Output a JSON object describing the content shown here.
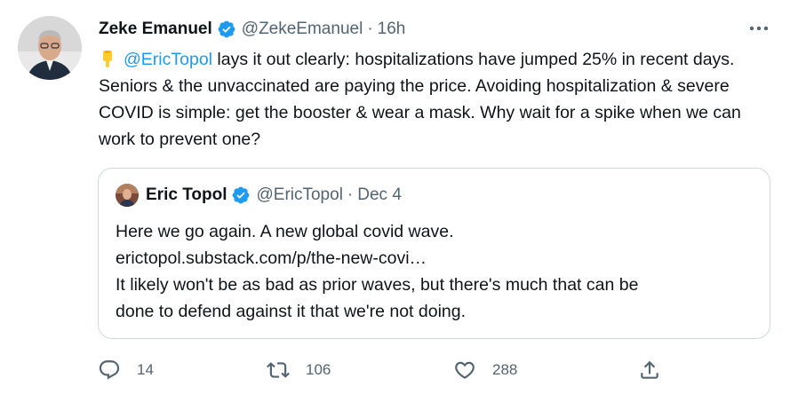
{
  "tweet": {
    "author_name": "Zeke Emanuel",
    "author_handle": "@ZekeEmanuel",
    "separator": "·",
    "time": "16h",
    "emoji": "👇",
    "mention": "@EricTopol",
    "text_rest": " lays it out clearly: hospitalizations have jumped 25% in recent days. Seniors & the unvaccinated are paying the price. Avoiding hospitalization & severe COVID is simple: get the booster & wear a mask. Why wait for a spike when we can work to prevent one?"
  },
  "quote": {
    "author_name": "Eric Topol",
    "author_handle": "@EricTopol",
    "separator": "·",
    "date": "Dec 4",
    "lines": [
      "Here we go again. A new global covid wave.",
      "erictopol.substack.com/p/the-new-covi…",
      "It likely won't be as bad as prior waves, but there's much that can be",
      "done to defend against it that we're not doing."
    ]
  },
  "actions": {
    "reply_count": "14",
    "retweet_count": "106",
    "like_count": "288"
  },
  "colors": {
    "accent": "#1d9bf0",
    "secondary_text": "#536471",
    "primary_text": "#0f1419",
    "border": "#cfd9de"
  },
  "icons": [
    "more-icon",
    "verified-icon",
    "pointing-down-emoji",
    "reply-icon",
    "retweet-icon",
    "like-icon",
    "share-icon"
  ]
}
